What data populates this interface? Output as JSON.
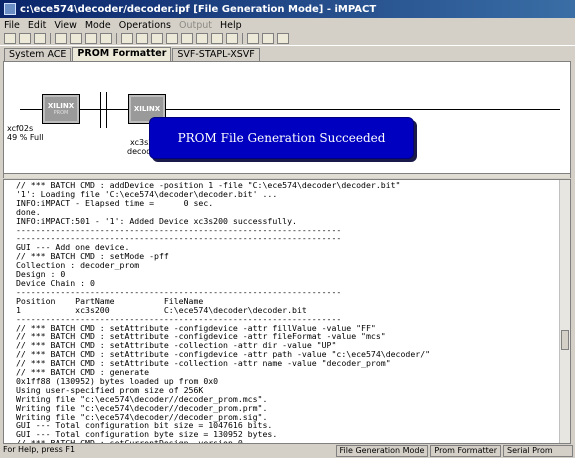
{
  "window": {
    "title": "c:\\ece574\\decoder/decoder.ipf [File Generation Mode] - iMPACT"
  },
  "menu": [
    "File",
    "Edit",
    "View",
    "Mode",
    "Operations",
    "Output",
    "Help"
  ],
  "tabs": [
    "System ACE",
    "PROM Formatter",
    "SVF-STAPL-XSVF"
  ],
  "canvas": {
    "device1": {
      "logo": "XILINX",
      "sub": "PROM",
      "label1": "xcf02s",
      "label2": "49 % Full"
    },
    "device2": {
      "logo": "XILINX",
      "label1": "xc3s2",
      "label2": "decode"
    },
    "toast": "PROM File Generation Succeeded"
  },
  "console_lines": [
    "// *** BATCH CMD : addDevice -position 1 -file \"C:\\ece574\\decoder\\decoder.bit\"",
    "'1': Loading file 'C:\\ece574\\decoder\\decoder.bit' ...",
    "INFO:iMPACT - Elapsed time =      0 sec.",
    "done.",
    "INFO:iMPACT:501 - '1': Added Device xc3s200 successfully.",
    "------------------------------------------------------------------",
    "------------------------------------------------------------------",
    "GUI --- Add one device.",
    "// *** BATCH CMD : setMode -pff",
    "Collection : decoder_prom",
    "Design : 0",
    "Device Chain : 0",
    "------------------------------------------------------------------",
    "Position    PartName          FileName",
    "1           xc3s200           C:\\ece574\\decoder\\decoder.bit",
    "------------------------------------------------------------------",
    "// *** BATCH CMD : setAttribute -configdevice -attr fillValue -value \"FF\"",
    "// *** BATCH CMD : setAttribute -configdevice -attr fileFormat -value \"mcs\"",
    "// *** BATCH CMD : setAttribute -collection -attr dir -value \"UP\"",
    "// *** BATCH CMD : setAttribute -configdevice -attr path -value \"c:\\ece574\\decoder/\"",
    "// *** BATCH CMD : setAttribute -collection -attr name -value \"decoder_prom\"",
    "// *** BATCH CMD : generate",
    "0x1ff88 (130952) bytes loaded up from 0x0",
    "Using user-specified prom size of 256K",
    "Writing file \"c:\\ece574\\decoder//decoder_prom.mcs\".",
    "Writing file \"c:\\ece574\\decoder//decoder_prom.prm\".",
    "Writing file \"c:\\ece574\\decoder//decoder_prom.sig\".",
    "GUI --- Total configuration bit size = 1047616 bits.",
    "GUI --- Total configuration byte size = 130952 bytes.",
    "// *** BATCH CMD : setCurrentDesign -version 0"
  ],
  "status": {
    "help": "For Help, press F1",
    "mode": "File Generation Mode",
    "formatter": "Prom Formatter",
    "target": "Serial Prom"
  }
}
